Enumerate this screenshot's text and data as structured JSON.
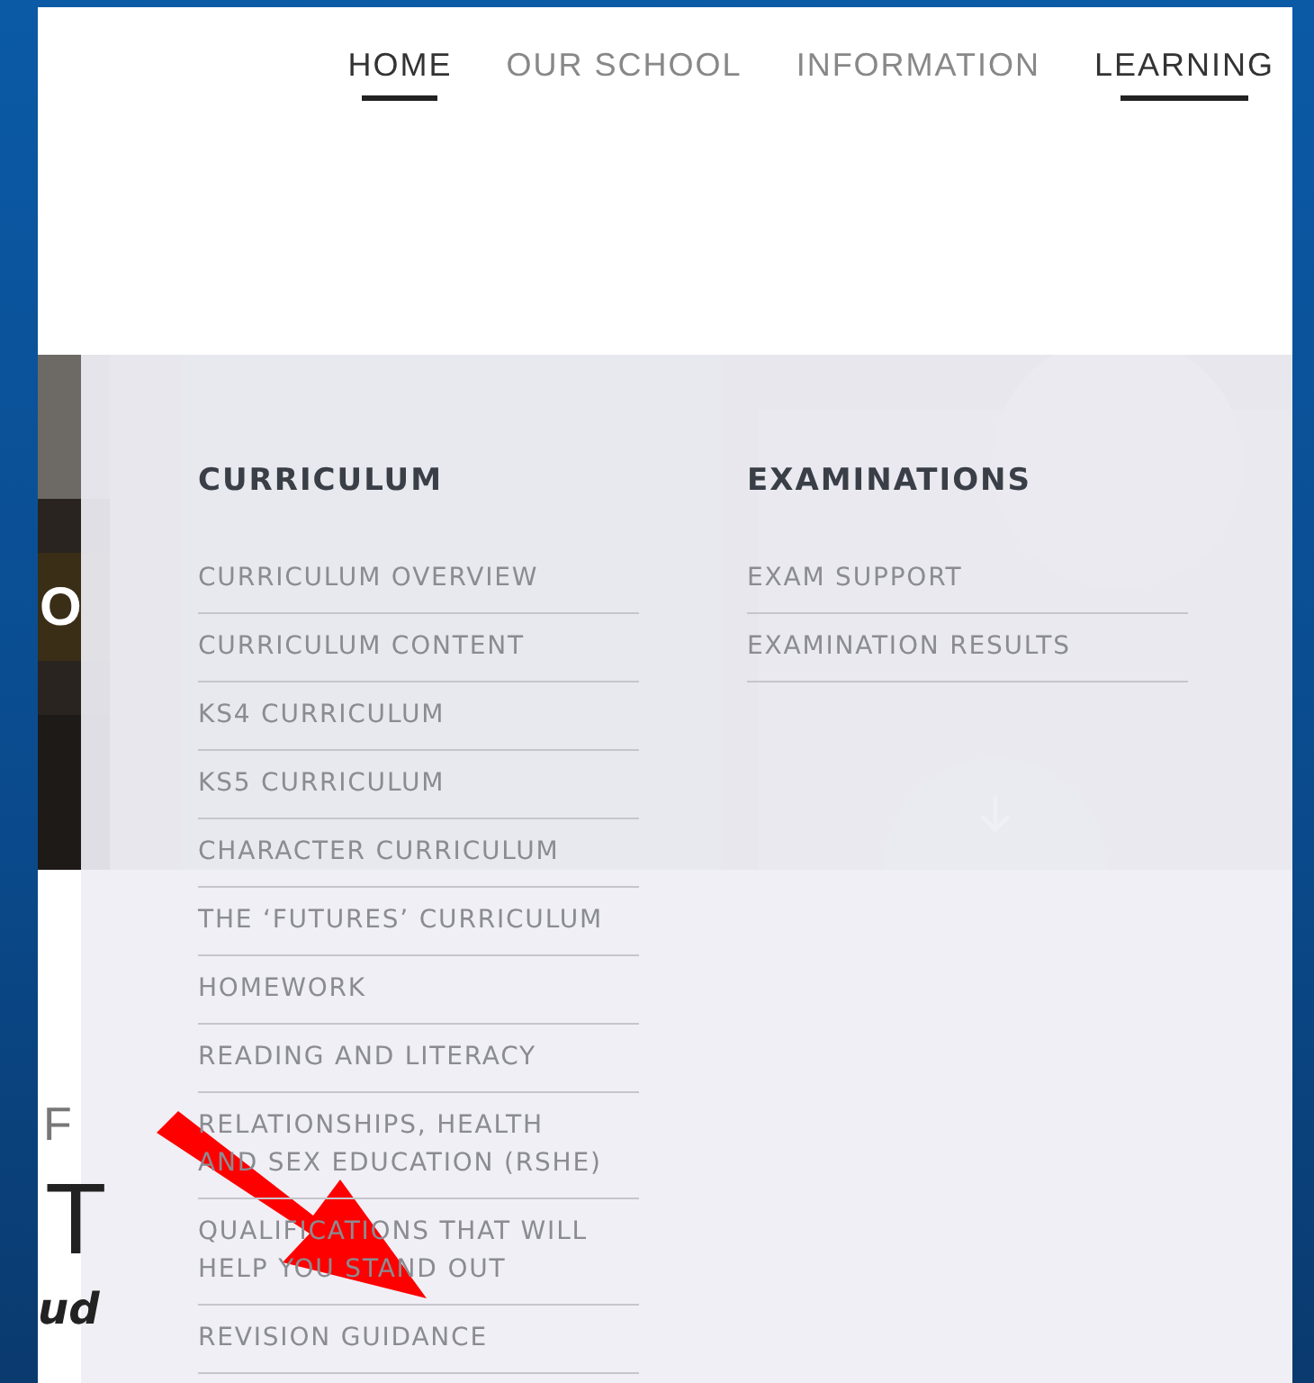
{
  "nav": [
    {
      "label": "HOME",
      "active": true
    },
    {
      "label": "OUR SCHOOL",
      "active": false
    },
    {
      "label": "INFORMATION",
      "active": false
    },
    {
      "label": "LEARNING",
      "active": true
    }
  ],
  "hero": {
    "headline": "O"
  },
  "below": {
    "small": "F",
    "initial": "T",
    "italic": "ud"
  },
  "dropdown": {
    "columns": [
      {
        "heading": "CURRICULUM",
        "items": [
          "CURRICULUM OVERVIEW",
          "CURRICULUM CONTENT",
          "KS4 CURRICULUM",
          "KS5 CURRICULUM",
          "CHARACTER CURRICULUM",
          "THE ‘FUTURES’ CURRICULUM",
          "HOMEWORK",
          "READING AND LITERACY",
          "RELATIONSHIPS, HEALTH AND SEX EDUCATION (RSHE)",
          "QUALIFICATIONS THAT WILL HELP YOU STAND OUT",
          "REVISION GUIDANCE"
        ]
      },
      {
        "heading": "EXAMINATIONS",
        "items": [
          "EXAM SUPPORT",
          "EXAMINATION RESULTS"
        ]
      }
    ]
  }
}
